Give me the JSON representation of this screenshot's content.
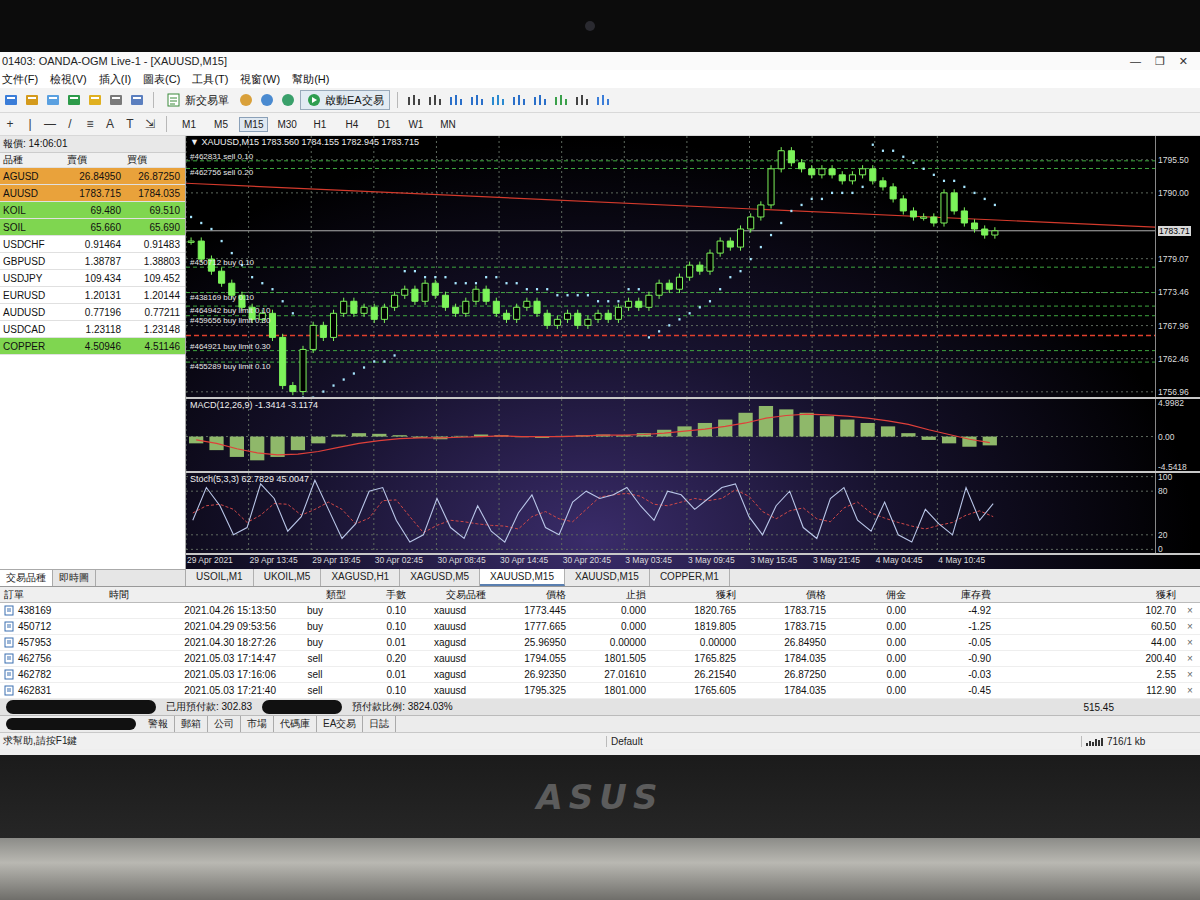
{
  "window": {
    "title": "01403: OANDA-OGM Live-1 - [XAUUSD,M15]",
    "controls": [
      "—",
      "❐",
      "✕"
    ]
  },
  "menu": [
    "文件(F)",
    "檢視(V)",
    "插入(I)",
    "圖表(C)",
    "工具(T)",
    "視窗(W)",
    "幫助(H)"
  ],
  "toolbar": {
    "new_order": "新交易單",
    "expert": "啟動EA交易",
    "drawing_tools": [
      "+",
      "|",
      "—",
      "/",
      "≡",
      "A",
      "T",
      "⇲"
    ],
    "timeframes": [
      {
        "label": "M1",
        "selected": false
      },
      {
        "label": "M5",
        "selected": false
      },
      {
        "label": "M15",
        "selected": true
      },
      {
        "label": "M30",
        "selected": false
      },
      {
        "label": "H1",
        "selected": false
      },
      {
        "label": "H4",
        "selected": false
      },
      {
        "label": "D1",
        "selected": false
      },
      {
        "label": "W1",
        "selected": false
      },
      {
        "label": "MN",
        "selected": false
      }
    ]
  },
  "market_watch": {
    "title": "報價: 14:06:01",
    "columns": [
      "品種",
      "賣價",
      "買價"
    ],
    "rows": [
      {
        "symbol": "AGUSD",
        "bid": "26.84950",
        "ask": "26.87250",
        "color": "#e9a23b"
      },
      {
        "symbol": "AUUSD",
        "bid": "1783.715",
        "ask": "1784.035",
        "color": "#e9a23b"
      },
      {
        "symbol": "KOIL",
        "bid": "69.480",
        "ask": "69.510",
        "color": "#7fd650"
      },
      {
        "symbol": "SOIL",
        "bid": "65.660",
        "ask": "65.690",
        "color": "#7fd650"
      },
      {
        "symbol": "USDCHF",
        "bid": "0.91464",
        "ask": "0.91483",
        "color": "#ffffff"
      },
      {
        "symbol": "GBPUSD",
        "bid": "1.38787",
        "ask": "1.38803",
        "color": "#ffffff"
      },
      {
        "symbol": "USDJPY",
        "bid": "109.434",
        "ask": "109.452",
        "color": "#ffffff"
      },
      {
        "symbol": "EURUSD",
        "bid": "1.20131",
        "ask": "1.20144",
        "color": "#ffffff"
      },
      {
        "symbol": "AUDUSD",
        "bid": "0.77196",
        "ask": "0.77211",
        "color": "#ffffff"
      },
      {
        "symbol": "USDCAD",
        "bid": "1.23118",
        "ask": "1.23148",
        "color": "#ffffff"
      },
      {
        "symbol": "COPPER",
        "bid": "4.50946",
        "ask": "4.51146",
        "color": "#7fd650"
      }
    ],
    "tabs": [
      {
        "label": "交易品種",
        "selected": true
      },
      {
        "label": "即時圖",
        "selected": false
      }
    ]
  },
  "chart": {
    "header": "▼ XAUUSD,M15 1783.560 1784.155 1782.945 1783.715",
    "price_axis": [
      "1795.50",
      "1790.00",
      "1779.07",
      "1773.46",
      "1767.96",
      "1762.46",
      "1756.96"
    ],
    "current_price": "1783.71",
    "trendline": [
      1791.6,
      1784.3
    ],
    "support_line": 1766.3,
    "orders": [
      {
        "label": "#462831 sell 0.10",
        "price": 1795.325
      },
      {
        "label": "#462756 sell 0.20",
        "price": 1794.055
      },
      {
        "label": "#450712 buy 0.10",
        "price": 1777.665
      },
      {
        "label": "#438169 buy 0.10",
        "price": 1773.445
      },
      {
        "label": "#464942 buy limit 0.10",
        "price": 1771.2
      },
      {
        "label": "#459656 buy limit 0.30",
        "price": 1769.6
      },
      {
        "label": "#464921 buy limit 0.30",
        "price": 1763.8
      },
      {
        "label": "#455289 buy limit 0.10",
        "price": 1761.9
      }
    ],
    "closes": [
      1782,
      1779,
      1777,
      1775,
      1773,
      1771,
      1769,
      1770,
      1766,
      1758,
      1757,
      1764,
      1768,
      1766,
      1770,
      1772,
      1770,
      1771,
      1769,
      1771,
      1773,
      1774,
      1772,
      1775,
      1773,
      1771,
      1770,
      1772,
      1774,
      1772,
      1770,
      1769,
      1771,
      1772,
      1770,
      1768,
      1769,
      1770,
      1768,
      1769,
      1770,
      1769,
      1771,
      1772,
      1771,
      1773,
      1775,
      1774,
      1776,
      1778,
      1777,
      1780,
      1782,
      1781,
      1784,
      1786,
      1788,
      1794,
      1797,
      1795,
      1794,
      1793,
      1794,
      1793,
      1792,
      1793,
      1794,
      1792,
      1791,
      1789,
      1787,
      1786,
      1786,
      1785,
      1790,
      1787,
      1785,
      1784,
      1783,
      1783.7
    ],
    "sar": [
      1786,
      1785,
      1784,
      1782,
      1780,
      1778,
      1776,
      1775,
      1774,
      1772,
      1770,
      1756,
      1756,
      1757,
      1758,
      1759,
      1760,
      1761,
      1762,
      1762,
      1763,
      1777,
      1777,
      1776,
      1776,
      1776,
      1775,
      1775,
      1775,
      1776,
      1776,
      1775,
      1775,
      1774,
      1774,
      1774,
      1773,
      1773,
      1773,
      1773,
      1772,
      1772,
      1772,
      1774,
      1774,
      1766,
      1767,
      1768,
      1769,
      1770,
      1771,
      1772,
      1774,
      1776,
      1777,
      1779,
      1781,
      1783,
      1785,
      1787,
      1788,
      1789,
      1789,
      1790,
      1790,
      1790,
      1791,
      1798,
      1797,
      1797,
      1796,
      1795,
      1794,
      1793,
      1792,
      1792,
      1791,
      1790,
      1789,
      1788
    ],
    "macd": {
      "title": "MACD(12,26,9) -1.3414 -3.1174",
      "axis": [
        "4.9982",
        "0.00",
        "-4.5418"
      ],
      "histogram": [
        -1,
        -2,
        -3,
        -3.5,
        -3,
        -2,
        -1,
        0.3,
        0.5,
        0.4,
        0.2,
        -0.2,
        -0.4,
        0.1,
        0.3,
        0.2,
        -0.1,
        -0.2,
        0.1,
        0.2,
        0.3,
        0.2,
        0.5,
        1,
        1.5,
        2,
        2.5,
        3.5,
        4.5,
        4,
        3.5,
        3,
        2.5,
        2,
        1.5,
        0.5,
        -0.5,
        -1,
        -1.5,
        -1.3
      ],
      "signal": [
        -0.5,
        -1,
        -1.8,
        -2.4,
        -2.7,
        -2.6,
        -2.2,
        -1.6,
        -1,
        -0.6,
        -0.3,
        -0.2,
        -0.2,
        -0.1,
        0,
        0.1,
        0,
        0,
        0,
        0.1,
        0.2,
        0.2,
        0.3,
        0.5,
        0.8,
        1.1,
        1.5,
        2,
        2.7,
        3.1,
        3.3,
        3.2,
        3,
        2.7,
        2.3,
        1.8,
        1,
        0.3,
        -0.4,
        -0.9
      ]
    },
    "stoch": {
      "title": "Stoch(5,3,3) 62.7829 45.0047",
      "axis": [
        "100",
        "80",
        "20",
        "0"
      ],
      "main": [
        40,
        85,
        60,
        20,
        30,
        90,
        70,
        25,
        45,
        95,
        55,
        15,
        35,
        80,
        85,
        40,
        10,
        20,
        70,
        30,
        15,
        60,
        25,
        10,
        50,
        75,
        30,
        20,
        65,
        80,
        70,
        75,
        85,
        60,
        40,
        80,
        75,
        55,
        70,
        85,
        90,
        45,
        20,
        60,
        80,
        30,
        15,
        70,
        85,
        40,
        25,
        65,
        20,
        10,
        55,
        35,
        20,
        85,
        40,
        62.8
      ],
      "signal": [
        50,
        60,
        62,
        55,
        37,
        47,
        63,
        62,
        47,
        55,
        65,
        55,
        35,
        43,
        67,
        68,
        45,
        23,
        33,
        40,
        38,
        35,
        33,
        32,
        28,
        45,
        52,
        42,
        38,
        55,
        72,
        75,
        77,
        73,
        62,
        60,
        65,
        70,
        67,
        70,
        82,
        73,
        52,
        42,
        53,
        57,
        42,
        38,
        57,
        65,
        50,
        43,
        37,
        32,
        28,
        33,
        37,
        47,
        53,
        45
      ]
    },
    "time_axis": [
      "29 Apr 2021",
      "29 Apr 13:45",
      "29 Apr 19:45",
      "30 Apr 02:45",
      "30 Apr 08:45",
      "30 Apr 14:45",
      "30 Apr 20:45",
      "3 May 03:45",
      "3 May 09:45",
      "3 May 15:45",
      "3 May 21:45",
      "4 May 04:45",
      "4 May 10:45"
    ],
    "tabs": [
      {
        "label": "USOIL,M1",
        "selected": false
      },
      {
        "label": "UKOIL,M5",
        "selected": false
      },
      {
        "label": "XAGUSD,H1",
        "selected": false
      },
      {
        "label": "XAGUSD,M5",
        "selected": false
      },
      {
        "label": "XAUUSD,M15",
        "selected": true
      },
      {
        "label": "XAUUSD,M15",
        "selected": false
      },
      {
        "label": "COPPER,M1",
        "selected": false
      }
    ]
  },
  "terminal": {
    "columns": [
      "訂單",
      "時間",
      "類型",
      "手數",
      "交易品種",
      "價格",
      "止損",
      "獲利",
      "價格",
      "佣金",
      "庫存費",
      "獲利"
    ],
    "rows": [
      {
        "ticket": "438169",
        "time": "2021.04.26 15:13:50",
        "type": "buy",
        "lots": "0.10",
        "symbol": "xauusd",
        "price": "1773.445",
        "sl": "0.000",
        "tp": "1820.765",
        "current": "1783.715",
        "commission": "0.00",
        "swap": "-4.92",
        "profit": "102.70"
      },
      {
        "ticket": "450712",
        "time": "2021.04.29 09:53:56",
        "type": "buy",
        "lots": "0.10",
        "symbol": "xauusd",
        "price": "1777.665",
        "sl": "0.000",
        "tp": "1819.805",
        "current": "1783.715",
        "commission": "0.00",
        "swap": "-1.25",
        "profit": "60.50"
      },
      {
        "ticket": "457953",
        "time": "2021.04.30 18:27:26",
        "type": "buy",
        "lots": "0.01",
        "symbol": "xagusd",
        "price": "25.96950",
        "sl": "0.00000",
        "tp": "0.00000",
        "current": "26.84950",
        "commission": "0.00",
        "swap": "-0.05",
        "profit": "44.00"
      },
      {
        "ticket": "462756",
        "time": "2021.05.03 17:14:47",
        "type": "sell",
        "lots": "0.20",
        "symbol": "xauusd",
        "price": "1794.055",
        "sl": "1801.505",
        "tp": "1765.825",
        "current": "1784.035",
        "commission": "0.00",
        "swap": "-0.90",
        "profit": "200.40"
      },
      {
        "ticket": "462782",
        "time": "2021.05.03 17:16:06",
        "type": "sell",
        "lots": "0.01",
        "symbol": "xagusd",
        "price": "26.92350",
        "sl": "27.01610",
        "tp": "26.21540",
        "current": "26.87250",
        "commission": "0.00",
        "swap": "-0.03",
        "profit": "2.55"
      },
      {
        "ticket": "462831",
        "time": "2021.05.03 17:21:40",
        "type": "sell",
        "lots": "0.10",
        "symbol": "xauusd",
        "price": "1795.325",
        "sl": "1801.000",
        "tp": "1765.605",
        "current": "1784.035",
        "commission": "0.00",
        "swap": "-0.45",
        "profit": "112.90"
      }
    ],
    "close_icon": "×",
    "balance": {
      "margin": "已用預付款: 302.83",
      "margin_level": "預付款比例: 3824.03%",
      "total": "515.45"
    },
    "tabs": [
      {
        "label": "警報",
        "selected": false
      },
      {
        "label": "郵箱",
        "selected": false
      },
      {
        "label": "公司",
        "selected": false
      },
      {
        "label": "市場",
        "selected": false
      },
      {
        "label": "代碼庫",
        "selected": false
      },
      {
        "label": "EA交易",
        "selected": false
      },
      {
        "label": "日誌",
        "selected": false
      }
    ]
  },
  "status_bar": {
    "help": "求幫助,請按F1鍵",
    "profile": "Default",
    "traffic": "716/1 kb"
  },
  "laptop": {
    "brand": "ASUS"
  }
}
